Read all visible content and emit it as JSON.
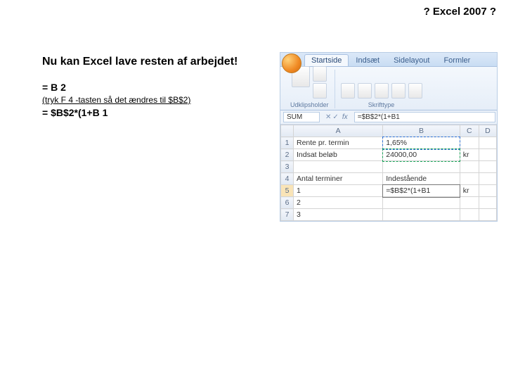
{
  "header": {
    "title": "? Excel 2007 ?"
  },
  "left": {
    "heading": "Nu kan Excel lave resten af arbejdet!",
    "formula1": "= B 2",
    "hint": "(tryk F 4 -tasten så det ændres til $B$2)",
    "formula2": "= $B$2*(1+B 1"
  },
  "ribbon": {
    "tabs": [
      "Startside",
      "Indsæt",
      "Sidelayout",
      "Formler"
    ],
    "groups": [
      {
        "label": "Udklipsholder"
      },
      {
        "label": "Skrifttype"
      }
    ]
  },
  "formulaBar": {
    "nameBox": "SUM",
    "fx": "fx",
    "input": "=$B$2*(1+B1"
  },
  "sheet": {
    "columns": [
      "A",
      "B",
      "C",
      "D"
    ],
    "rows": [
      {
        "n": "1",
        "a": "Rente pr. termin",
        "b": "1,65%",
        "c": "",
        "d": ""
      },
      {
        "n": "2",
        "a": "Indsat beløb",
        "b": "24000,00",
        "c": "kr",
        "d": ""
      },
      {
        "n": "3",
        "a": "",
        "b": "",
        "c": "",
        "d": ""
      },
      {
        "n": "4",
        "a": "Antal terminer",
        "b": "Indestående",
        "c": "",
        "d": ""
      },
      {
        "n": "5",
        "a": "1",
        "b": "=$B$2*(1+B1",
        "c": "kr",
        "d": ""
      },
      {
        "n": "6",
        "a": "2",
        "b": "",
        "c": "",
        "d": ""
      },
      {
        "n": "7",
        "a": "3",
        "b": "",
        "c": "",
        "d": ""
      }
    ]
  }
}
